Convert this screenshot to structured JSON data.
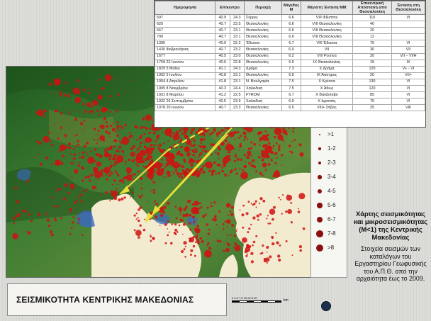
{
  "table": {
    "headers": [
      "Ημερομηνία",
      "Επίκεντρο",
      "",
      "Περιοχή",
      "Μέγεθος M",
      "Μέγιστη Ένταση MM",
      "Επικεντρική Απόσταση από Θεσσαλονίκη",
      "Ένταση στη Θεσσαλονίκη"
    ],
    "rows": [
      [
        "597",
        "40.9",
        "24.3",
        "Σέρρες",
        "6.6",
        "VIII Φίλιπποι",
        "110",
        "VI"
      ],
      [
        "620",
        "40.7",
        "23.5",
        "Θεσσαλονίκη",
        "6.6",
        "VIII Θεσσαλονίκη",
        "40",
        ""
      ],
      [
        "667",
        "40.7",
        "23.1",
        "Θεσσαλονίκη",
        "6.6",
        "VIII Θεσσαλονίκη",
        "20",
        ""
      ],
      [
        "700",
        "40.7",
        "23.1",
        "Θεσσαλονίκη",
        "6.6",
        "VIII Θεσσαλονίκη",
        "12",
        ""
      ],
      [
        "1395",
        "40.9",
        "22.2",
        "Έδεσσα",
        "6.7",
        "VIII Έδεσσα",
        "70",
        "VI"
      ],
      [
        "1430 Φεβρουάριος",
        "40.7",
        "23.2",
        "Θεσσαλονίκη",
        "6.0",
        "VII",
        "30",
        "VII"
      ],
      [
        "1677",
        "40.5",
        "23.0",
        "Θεσσαλονίκη",
        "6.2",
        "VIII Ρεντίνα",
        "20",
        "VII – VIIH"
      ],
      [
        "1759 22 Ιουνίου",
        "40.6",
        "22.8",
        "Θεσσαλονίκη",
        "6.5",
        "IX Θεσσαλονίκη",
        "15",
        "IX"
      ],
      [
        "1829 5 Μαΐου",
        "41.1",
        "24.3",
        "Δράμα",
        "7.3",
        "X Δράμα",
        "120",
        "V+ - VI"
      ],
      [
        "1902 5 Ιουλίου",
        "40.8",
        "23.1",
        "Θεσσαλονίκη",
        "6.6",
        "IX Άσσηρος",
        "20",
        "VII+"
      ],
      [
        "1904 4 Απριλίου",
        "41.8",
        "23.1",
        "N. Βουλγαρία",
        "7.5",
        "X Κρέσνα",
        "130",
        "VI"
      ],
      [
        "1905 8 Νοεμβρίου",
        "40.3",
        "24.4",
        "Χαλκιδική",
        "7.5",
        "X Άθως",
        "120",
        "VI"
      ],
      [
        "1931 8 Μαρτίου",
        "41.2",
        "22.5",
        "FYROM",
        "6.7",
        "X Βαλάνταβο",
        "85",
        "VI"
      ],
      [
        "1932 26 Σεπτεμβρίου",
        "40.5",
        "23.9",
        "Χαλκιδική",
        "6.9",
        "X Ιερισσός",
        "75",
        "VI"
      ],
      [
        "1978 20 Ιουνίου",
        "40.7",
        "23.3",
        "Θεσσαλονίκη",
        "6.5",
        "VIII+ Στίβος",
        "25",
        "VIII"
      ]
    ]
  },
  "legend": {
    "items": [
      ">1",
      "1-2",
      "2-3",
      "3-4",
      "4-5",
      "5-6",
      "6-7",
      "7-8",
      ">8"
    ],
    "color": "#8a0f0f"
  },
  "caption": {
    "title": "Χάρτης σεισμικότητας και μικροσεισμικότητας (M<1) της Κεντρικής Μακεδονίας",
    "body": "Στοιχεία σεισμών των καταλόγων του Εργαστηρίου Γεωφυσικής του Α.Π.Θ. από την αρχαιότητα έως το 2009."
  },
  "title": "ΣΕΙΣΜΙΚΟΤΗΤΑ ΚΕΝΤΡΙΚΗΣ ΜΑΚΕΔΟΝΙΑΣ",
  "scale": {
    "ticks": "0 2.5 7.5 15 22.5 30",
    "unit": "km"
  },
  "colors": {
    "land_dark": "#2f6a2a",
    "land_light": "#f3ebcf",
    "epicenter": "#d01010",
    "arrow": "#e6e23a"
  }
}
